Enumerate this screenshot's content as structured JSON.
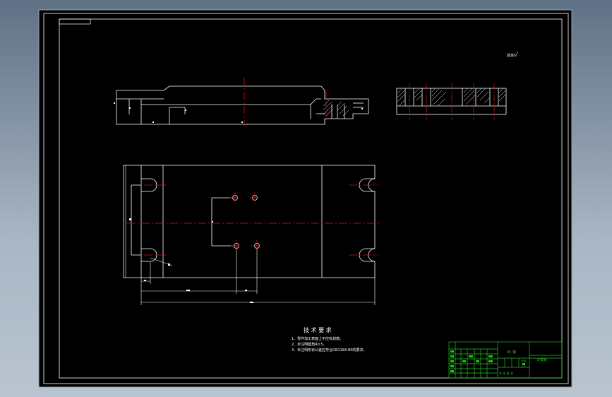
{
  "drawing": {
    "scale_label": "比例",
    "roughness_label": "其余",
    "tech_requirements": {
      "title": "技 术 要 求",
      "items": [
        "1、零件加工表面上不应有划痕。",
        "2、未注明圆角R0.5。",
        "3、未注明形状公差应符合GB1184-80的要求。"
      ]
    },
    "title_block": {
      "material": "45 钢",
      "part_name": "定模板",
      "scale_value": "1:1",
      "sheet_label": "共 张 第 张"
    }
  },
  "colors": {
    "background": "#000000",
    "line": "#ffffff",
    "center_line": "#e01010",
    "title_block": "#22c322",
    "hatch": "#ffffff"
  }
}
